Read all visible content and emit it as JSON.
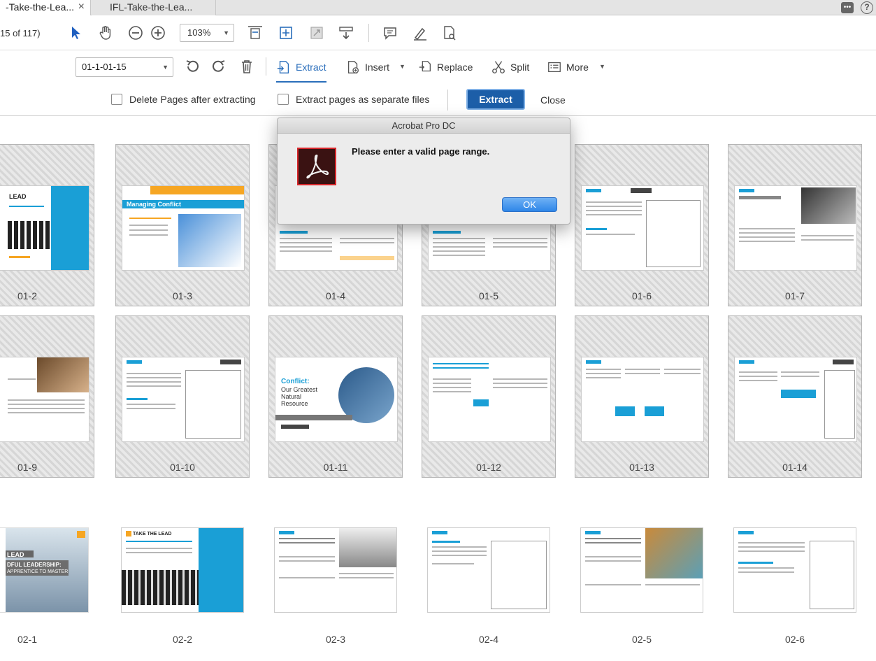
{
  "tabs": [
    {
      "label": "-Take-the-Lea...",
      "active": true
    },
    {
      "label": "IFL-Take-the-Lea...",
      "active": false
    }
  ],
  "tab_close_glyph": "×",
  "toolbar": {
    "page_count": "15 of 117)",
    "zoom": "103%",
    "icons": [
      "select-arrow-icon",
      "hand-icon",
      "zoom-out-icon",
      "zoom-in-icon",
      "fit-page-icon",
      "full-screen-icon",
      "rotate-view-icon",
      "scroll-mode-icon",
      "comment-icon",
      "highlight-icon",
      "fill-sign-icon"
    ]
  },
  "organize": {
    "range_value": "01-1-01-15",
    "extract_label": "Extract",
    "insert_label": "Insert",
    "replace_label": "Replace",
    "split_label": "Split",
    "more_label": "More"
  },
  "extract_bar": {
    "delete_pages_label": "Delete Pages after extracting",
    "separate_files_label": "Extract pages as separate files",
    "extract_button": "Extract",
    "close_button": "Close"
  },
  "pages": [
    {
      "label": "01-2",
      "selected": true
    },
    {
      "label": "01-3",
      "selected": true
    },
    {
      "label": "01-4",
      "selected": true
    },
    {
      "label": "01-5",
      "selected": true
    },
    {
      "label": "01-6",
      "selected": true
    },
    {
      "label": "01-7",
      "selected": true
    },
    {
      "label": "01-9",
      "selected": true
    },
    {
      "label": "01-10",
      "selected": true
    },
    {
      "label": "01-11",
      "selected": true
    },
    {
      "label": "01-12",
      "selected": true
    },
    {
      "label": "01-13",
      "selected": true
    },
    {
      "label": "01-14",
      "selected": true
    },
    {
      "label": "02-1",
      "selected": false
    },
    {
      "label": "02-2",
      "selected": false
    },
    {
      "label": "02-3",
      "selected": false
    },
    {
      "label": "02-4",
      "selected": false
    },
    {
      "label": "02-5",
      "selected": false
    },
    {
      "label": "02-6",
      "selected": false
    }
  ],
  "thumb_text": {
    "p2_title": "LEAD",
    "p3_title": "Managing Conflict",
    "p11_title": "Conflict:",
    "p11_sub1": "Our Greatest",
    "p11_sub2": "Natural",
    "p11_sub3": "Resource",
    "p21_title": "LEAD",
    "p21_sub": "DFUL LEADERSHIP:",
    "p21_sub2": "APPRENTICE TO MASTER",
    "p22_title": "TAKE THE LEAD"
  },
  "dialog": {
    "title": "Acrobat Pro DC",
    "message": "Please enter a valid page range.",
    "ok_label": "OK"
  },
  "colors": {
    "accent_blue": "#2a6ebb",
    "extract_button": "#1c5ea8",
    "thumb_blue": "#1a9fd6",
    "adobe_red": "#d6262a"
  }
}
